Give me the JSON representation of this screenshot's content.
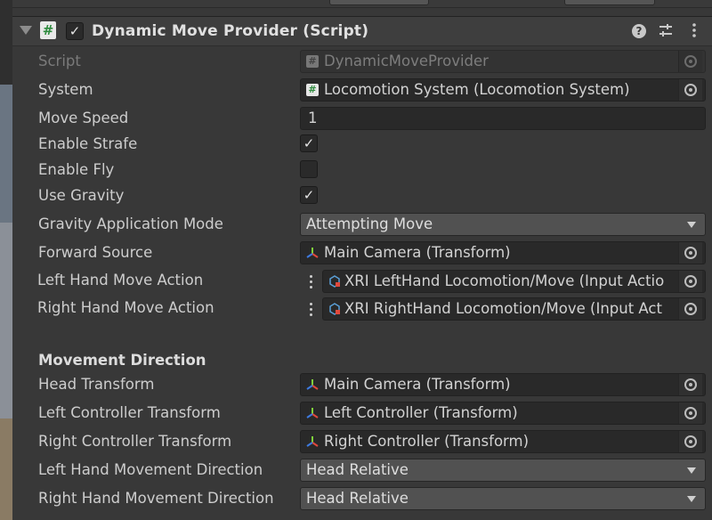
{
  "component": {
    "title": "Dynamic Move Provider (Script)",
    "enabled": true,
    "icons": [
      "help-icon",
      "preset-sliders-icon",
      "kebab-menu-icon"
    ]
  },
  "fields": {
    "script": {
      "label": "Script",
      "value": "DynamicMoveProvider"
    },
    "system": {
      "label": "System",
      "value": "Locomotion System (Locomotion System)"
    },
    "move_speed": {
      "label": "Move Speed",
      "value": "1"
    },
    "enable_strafe": {
      "label": "Enable Strafe",
      "checked": true,
      "mark": "✓"
    },
    "enable_fly": {
      "label": "Enable Fly",
      "checked": false,
      "mark": ""
    },
    "use_gravity": {
      "label": "Use Gravity",
      "checked": true,
      "mark": "✓"
    },
    "gravity_mode": {
      "label": "Gravity Application Mode",
      "value": "Attempting Move"
    },
    "forward_source": {
      "label": "Forward Source",
      "value": "Main Camera (Transform)"
    },
    "left_move_action": {
      "label": "Left Hand Move Action",
      "value": "XRI LeftHand Locomotion/Move (Input Actio"
    },
    "right_move_action": {
      "label": "Right Hand Move Action",
      "value": "XRI RightHand Locomotion/Move (Input Act"
    }
  },
  "movement_direction": {
    "section_title": "Movement Direction",
    "head_transform": {
      "label": "Head Transform",
      "value": "Main Camera (Transform)"
    },
    "left_controller": {
      "label": "Left Controller Transform",
      "value": "Left Controller (Transform)"
    },
    "right_controller": {
      "label": "Right Controller Transform",
      "value": "Right Controller (Transform)"
    },
    "left_direction": {
      "label": "Left Hand Movement Direction",
      "value": "Head Relative"
    },
    "right_direction": {
      "label": "Right Hand Movement Direction",
      "value": "Head Relative"
    }
  },
  "icon_chars": {
    "script": "#",
    "help": "?"
  }
}
